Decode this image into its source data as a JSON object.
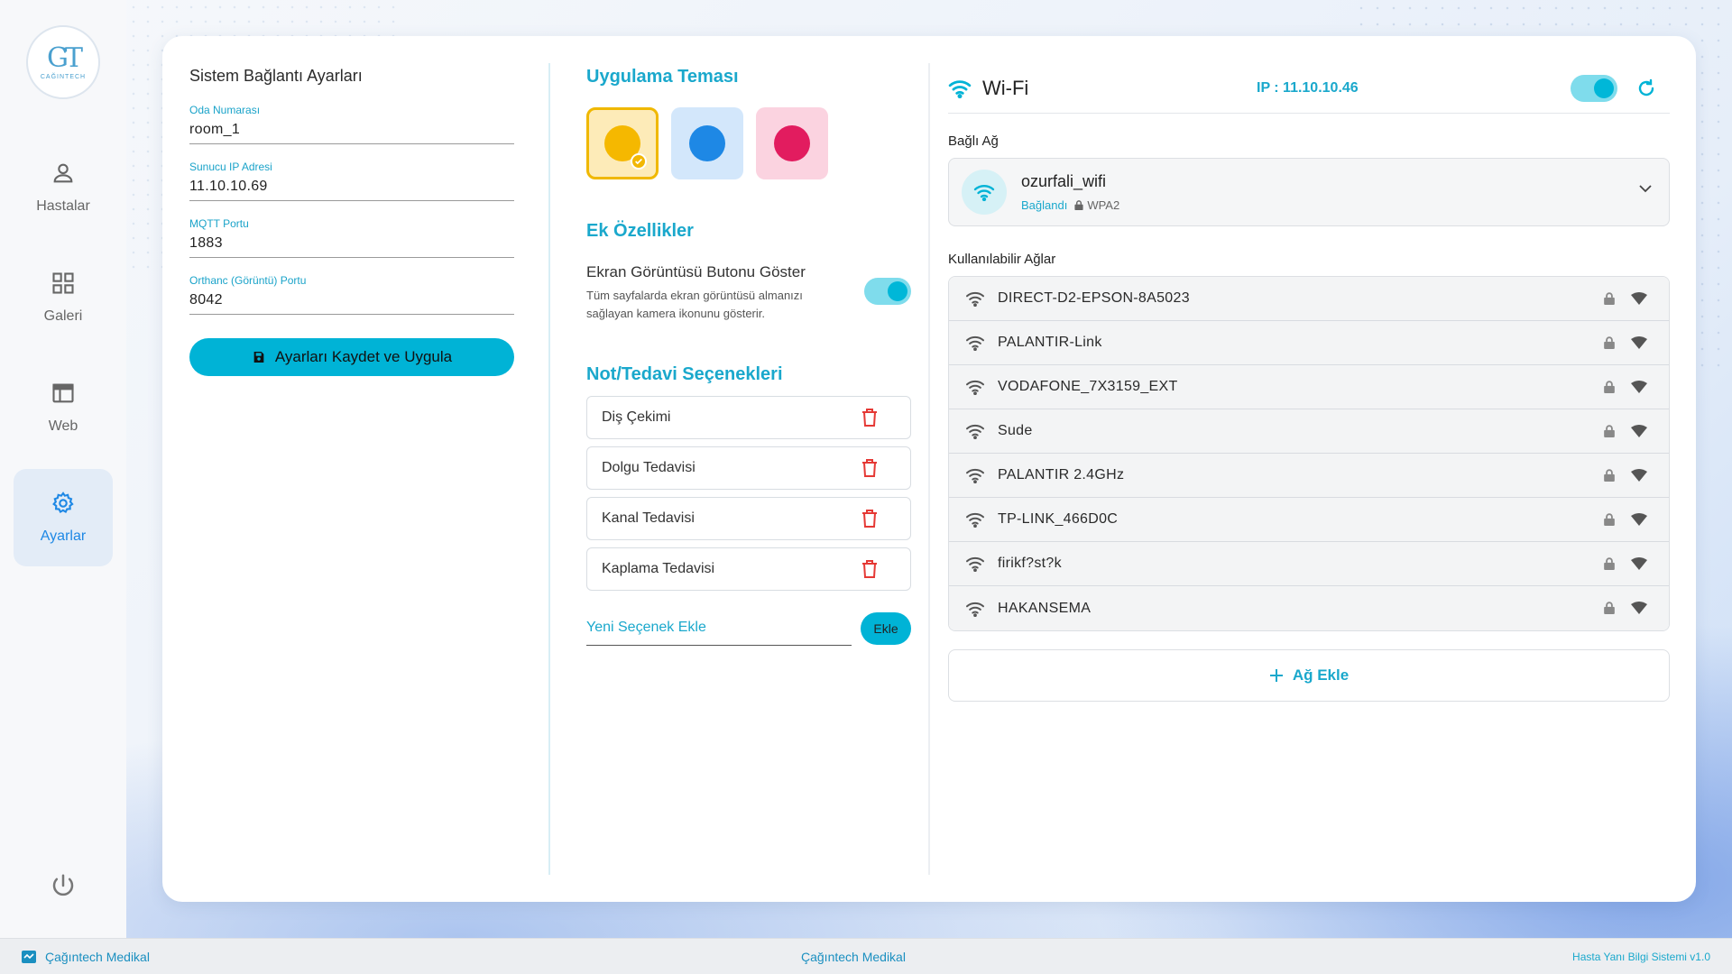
{
  "sidebar": {
    "logo_text": "CAĞINTECH",
    "items": [
      {
        "label": "Hastalar",
        "icon": "person-icon"
      },
      {
        "label": "Galeri",
        "icon": "grid-icon"
      },
      {
        "label": "Web",
        "icon": "browser-icon"
      },
      {
        "label": "Ayarlar",
        "icon": "gear-icon",
        "active": true
      }
    ]
  },
  "connection": {
    "title": "Sistem Bağlantı Ayarları",
    "fields": [
      {
        "label": "Oda Numarası",
        "value": "room_1"
      },
      {
        "label": "Sunucu IP Adresi",
        "value": "11.10.10.69"
      },
      {
        "label": "MQTT Portu",
        "value": "1883"
      },
      {
        "label": "Orthanc (Görüntü) Portu",
        "value": "8042"
      }
    ],
    "save_label": "Ayarları Kaydet ve Uygula"
  },
  "theme": {
    "title": "Uygulama Teması",
    "options": [
      {
        "name": "yellow",
        "bg": "#fdebb8",
        "color": "#f5b800",
        "selected": true
      },
      {
        "name": "blue",
        "bg": "#d3e7fb",
        "color": "#1e88e5",
        "selected": false
      },
      {
        "name": "pink",
        "bg": "#fbd3e0",
        "color": "#e21c5f",
        "selected": false
      }
    ]
  },
  "extras": {
    "title": "Ek Özellikler",
    "screenshot_option": {
      "label": "Ekran Görüntüsü Butonu Göster",
      "description": "Tüm sayfalarda ekran görüntüsü almanızı sağlayan kamera ikonunu gösterir.",
      "enabled": true
    }
  },
  "notes": {
    "title": "Not/Tedavi Seçenekleri",
    "items": [
      "Diş Çekimi",
      "Dolgu Tedavisi",
      "Kanal Tedavisi",
      "Kaplama Tedavisi"
    ],
    "new_placeholder": "Yeni Seçenek Ekle",
    "add_label": "Ekle"
  },
  "wifi": {
    "title": "Wi-Fi",
    "ip": "IP : 11.10.10.46",
    "enabled": true,
    "connected_label": "Bağlı Ağ",
    "connected": {
      "ssid": "ozurfali_wifi",
      "status": "Bağlandı",
      "security": "WPA2"
    },
    "available_label": "Kullanılabilir Ağlar",
    "networks": [
      "DIRECT-D2-EPSON-8A5023",
      "PALANTIR-Link",
      "VODAFONE_7X3159_EXT",
      "Sude",
      "PALANTIR 2.4GHz",
      "TP-LINK_466D0C",
      "firikf?st?k",
      "HAKANSEMA"
    ],
    "add_network_label": "Ağ Ekle"
  },
  "footer": {
    "left": "Çağıntech Medikal",
    "center": "Çağıntech Medikal",
    "right": "Hasta Yanı Bilgi Sistemi v1.0"
  },
  "colors": {
    "accent": "#00b3d6",
    "accent_text": "#1aa8cc",
    "active_nav": "#1e88e5",
    "delete": "#e53935"
  }
}
